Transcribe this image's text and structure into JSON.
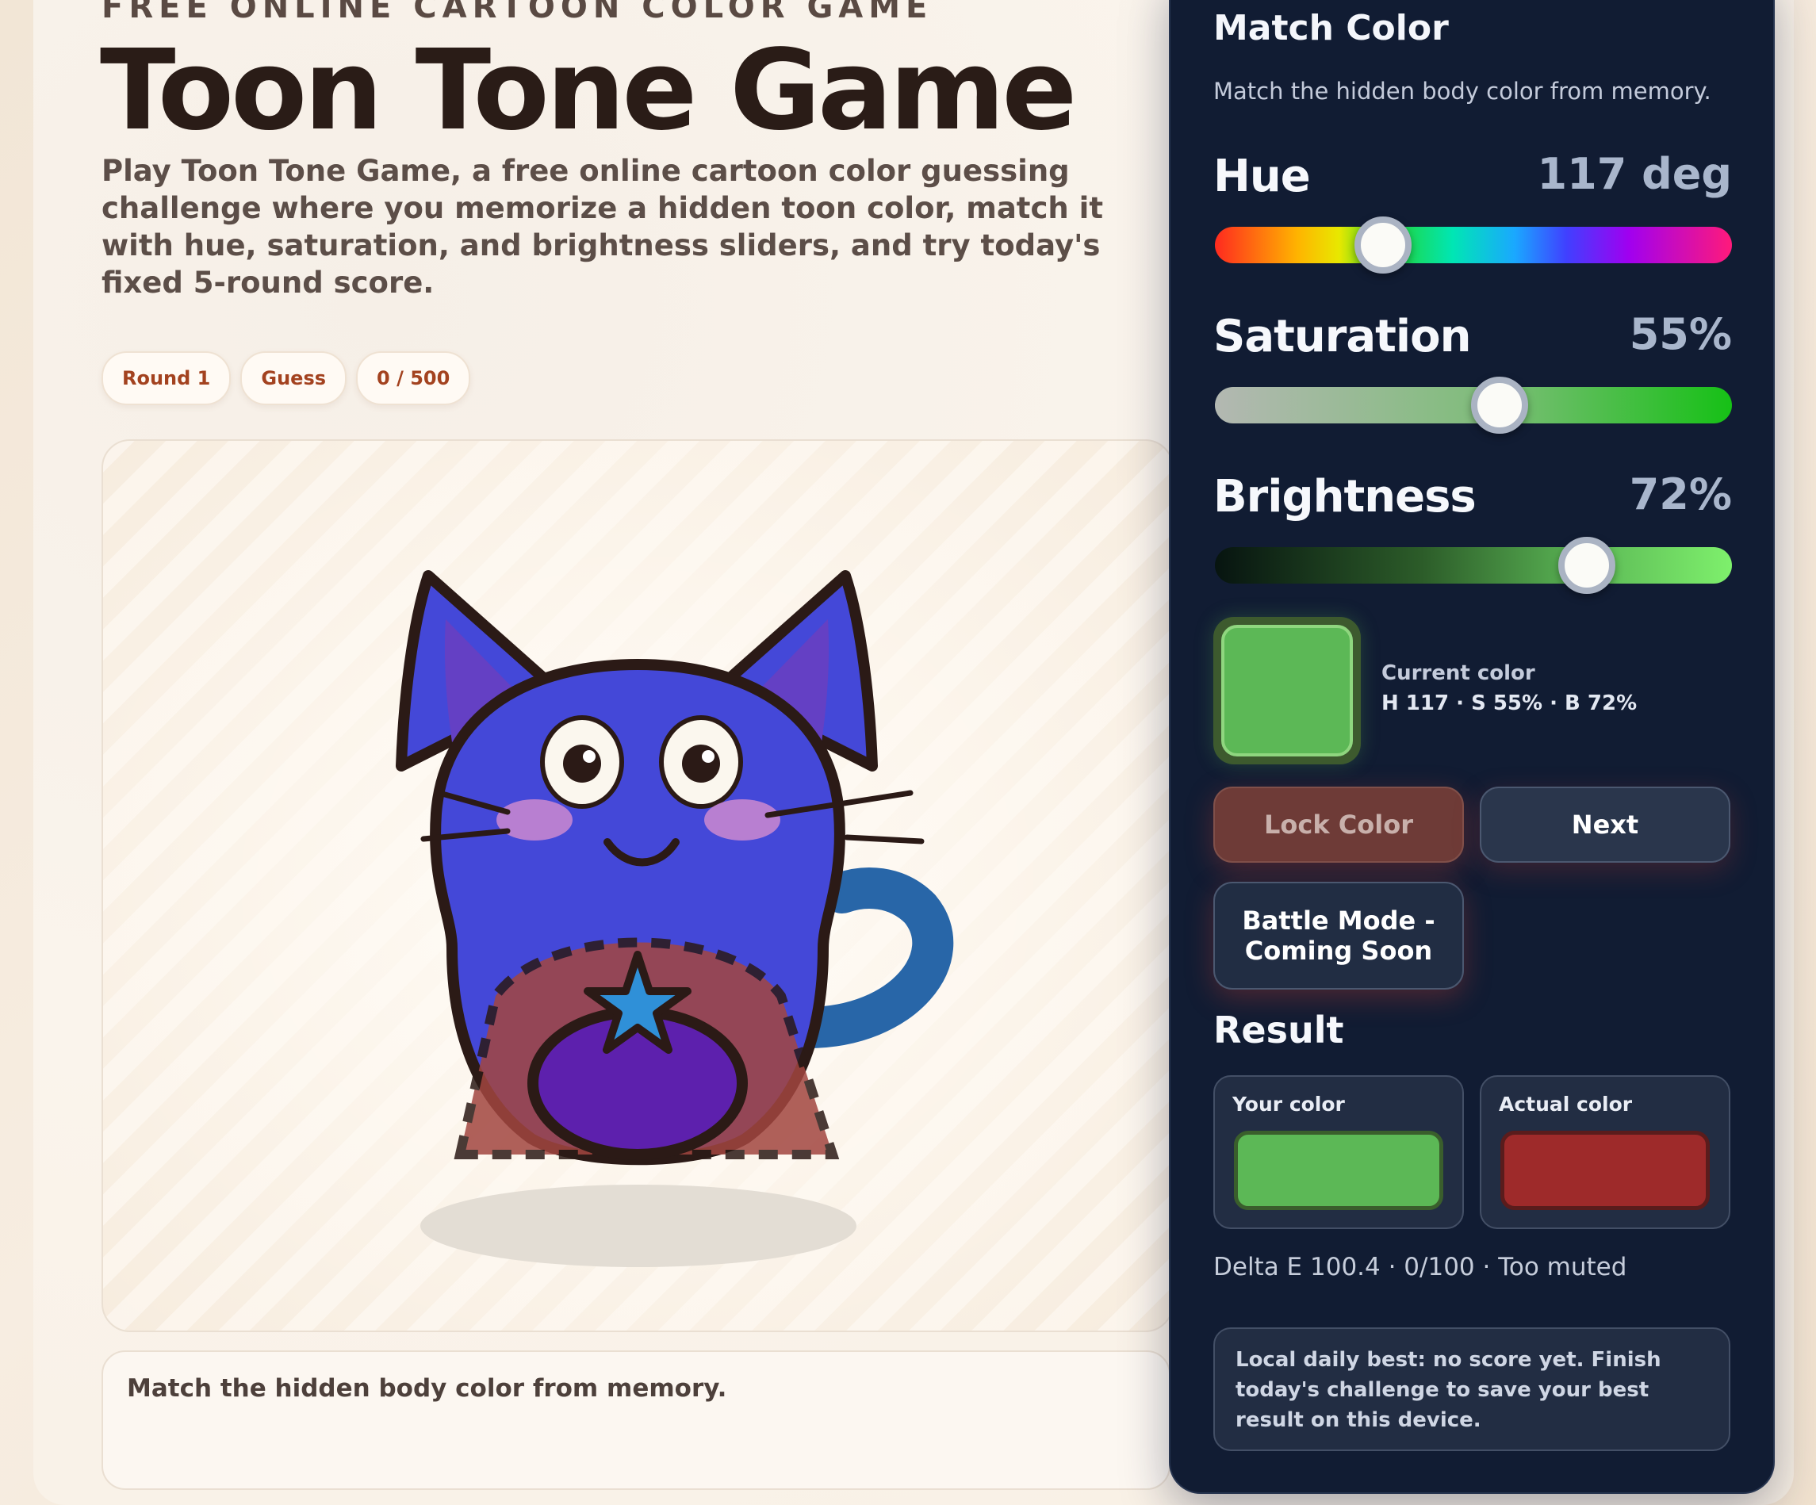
{
  "header": {
    "eyebrow": "FREE ONLINE CARTOON COLOR GAME",
    "title": "Toon Tone Game",
    "intro": "Play Toon Tone Game, a free online cartoon color guessing challenge where you memorize a hidden toon color, match it with hue, saturation, and brightness sliders, and try today's fixed 5-round score."
  },
  "chips": {
    "round": "Round 1",
    "phase": "Guess",
    "score": "0 / 500"
  },
  "stage": {
    "hint": "Match the hidden body color from memory.",
    "colors": {
      "body": "#4448d8",
      "outline": "#2b1a16",
      "ear_inner": "#6440c4",
      "cape": "#a24640",
      "belly": "#5d20ad",
      "star": "#2f90d8",
      "tail": "#2866a8",
      "blush": "#cc8ad0"
    }
  },
  "panel": {
    "title": "Match Color",
    "subtitle": "Match the hidden body color from memory.",
    "hue": {
      "label": "Hue",
      "value_text": "117 deg",
      "value": 117,
      "max": 360
    },
    "saturation": {
      "label": "Saturation",
      "value_text": "55%",
      "value": 55,
      "max": 100
    },
    "brightness": {
      "label": "Brightness",
      "value_text": "72%",
      "value": 72,
      "max": 100
    },
    "current_color": {
      "label": "Current color",
      "value": "H 117 · S 55% · B 72%",
      "hex": "#5cb856"
    },
    "buttons": {
      "lock": "Lock Color",
      "next": "Next",
      "battle": "Battle Mode - Coming Soon"
    },
    "result": {
      "title": "Result",
      "your_label": "Your color",
      "your_hex": "#5cb856",
      "actual_label": "Actual color",
      "actual_hex": "#9e2a2a",
      "delta": "Delta E 100.4 · 0/100 · Too muted"
    },
    "daily_best": "Local daily best: no score yet. Finish today's challenge to save your best result on this device."
  }
}
